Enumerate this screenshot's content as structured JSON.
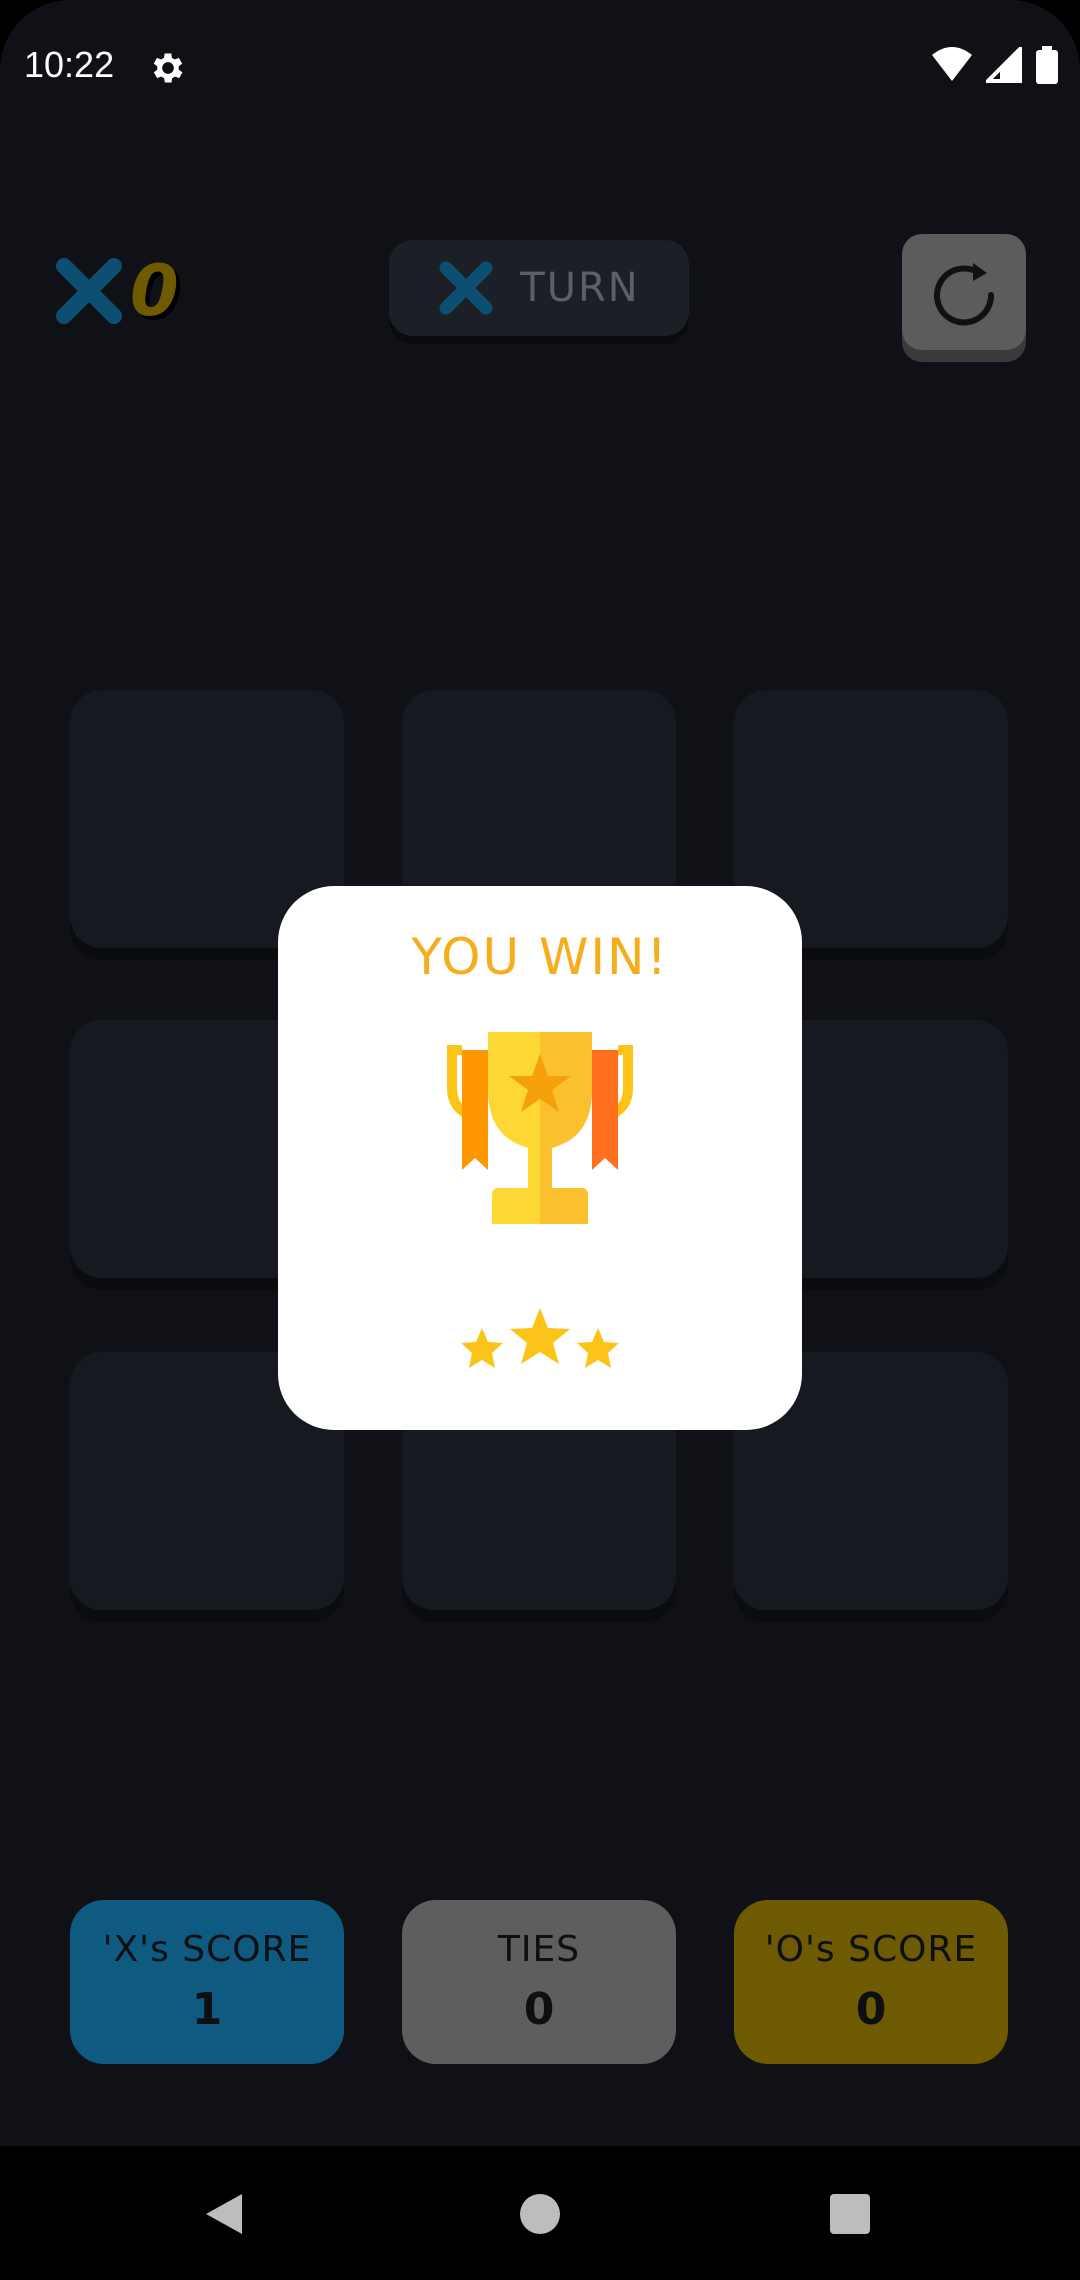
{
  "status_bar": {
    "time": "10:22"
  },
  "top_bar": {
    "x_count": "0",
    "turn_label": "TURN"
  },
  "modal": {
    "title": "YOU WIN!"
  },
  "scores": {
    "x": {
      "label": "'X's SCORE",
      "value": "1",
      "color": "#0e5a80"
    },
    "ties": {
      "label": "TIES",
      "value": "0",
      "color": "#5e5e5e"
    },
    "o": {
      "label": "'O's SCORE",
      "value": "0",
      "color": "#6e5a00"
    }
  },
  "colors": {
    "x_blue": "#0c4f73",
    "o_yellow": "#6e5a00",
    "trophy_gold": "#fcc419"
  },
  "icons": [
    "gear-icon",
    "wifi-icon",
    "signal-icon",
    "battery-icon",
    "x-mark-icon",
    "restart-icon",
    "trophy-icon",
    "star-icon",
    "back-icon",
    "home-icon",
    "recents-icon"
  ]
}
